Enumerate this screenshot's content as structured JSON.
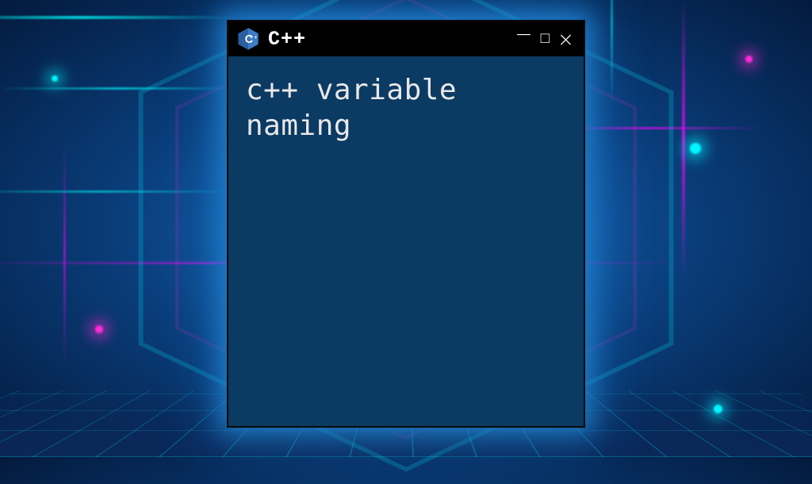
{
  "window": {
    "title": "C++",
    "icon_name": "cpp-hex-icon",
    "controls": {
      "minimize": "−",
      "maximize": "□",
      "close": "×"
    }
  },
  "content": {
    "text": "c++ variable naming"
  },
  "colors": {
    "window_bg": "#0b3a63",
    "titlebar_bg": "#000000",
    "glow": "#28a0ff",
    "text": "#e8e8e8"
  }
}
